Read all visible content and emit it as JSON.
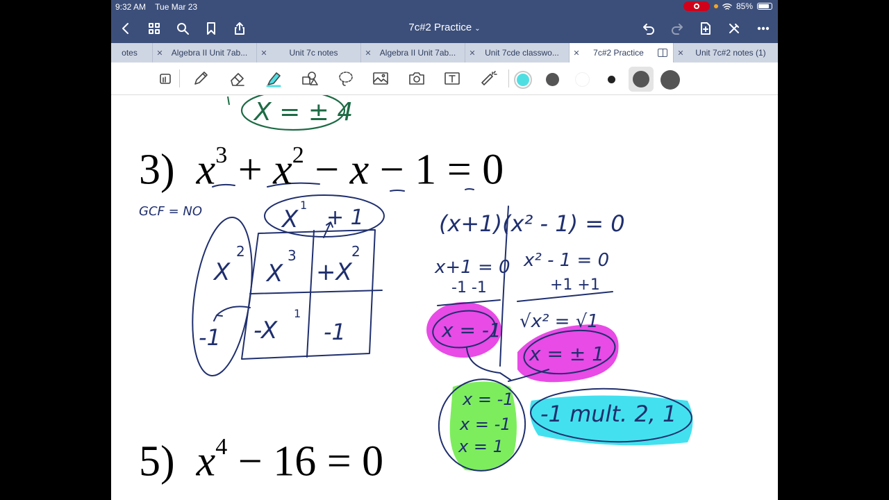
{
  "status": {
    "time": "9:32 AM",
    "date": "Tue Mar 23",
    "battery": "85%",
    "battery_level": 0.85
  },
  "nav": {
    "title": "7c#2 Practice"
  },
  "tabs": [
    {
      "label": "otes",
      "active": false,
      "closable": false
    },
    {
      "label": "Algebra II Unit 7ab...",
      "active": false,
      "closable": true
    },
    {
      "label": "Unit 7c notes",
      "active": false,
      "closable": true
    },
    {
      "label": "Algebra II Unit 7ab...",
      "active": false,
      "closable": true
    },
    {
      "label": "Unit 7cde classwo...",
      "active": false,
      "closable": true
    },
    {
      "label": "7c#2 Practice",
      "active": true,
      "closable": true
    },
    {
      "label": "Unit 7c#2 notes (1)",
      "active": false,
      "closable": true
    }
  ],
  "colors": {
    "header": "#3c4f7a",
    "ink_navy": "#1f2f6e",
    "ink_green": "#1d6b45",
    "highlight_magenta": "#e84be6",
    "highlight_green": "#7ded5d",
    "highlight_cyan": "#43e1ef",
    "swatch_cyan": "#4fdfe3",
    "swatch_gray": "#555555",
    "swatch_white": "#ffffff",
    "swatch_black": "#222222"
  },
  "problem3": {
    "number": "3)",
    "x": "x",
    "exp3": "3",
    "plus": "+",
    "exp2": "2",
    "minus": "−",
    "one": "1",
    "equals": "=",
    "zero": "0"
  },
  "problem5": {
    "number": "5)",
    "x": "x",
    "exp4": "4",
    "minus": "−",
    "sixteen": "16",
    "equals": "=",
    "zero": "0"
  },
  "handwriting": {
    "top_answer": "X = ± 4",
    "gcf": "GCF = NO",
    "box_top_x": "X",
    "box_top_exp": "1",
    "box_top_plus1": "+ 1",
    "left_x": "X",
    "left_exp": "2",
    "left_neg1": "-1",
    "cell_a": "X",
    "cell_a_exp": "3",
    "cell_b": "+X",
    "cell_b_exp": "2",
    "cell_c": "-X",
    "cell_c_exp": "1",
    "cell_d": "-1",
    "factored": "(x+1)(x² - 1) = 0",
    "left_eq": "x+1 = 0",
    "left_sub": "-1  -1",
    "left_ans": "x = -1",
    "right_eq": "x² - 1 = 0",
    "right_add": "+1  +1",
    "right_sqrt": "√x² = √1",
    "right_ans": "x = ± 1",
    "list1": "x = -1",
    "list2": "x = -1",
    "list3": "x = 1",
    "mult": "-1 mult. 2, 1"
  }
}
